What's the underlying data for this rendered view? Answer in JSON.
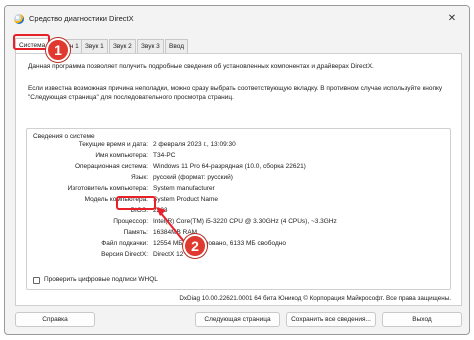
{
  "window": {
    "title": "Средство диагностики DirectX",
    "close_glyph": "✕"
  },
  "tabs": [
    "Система",
    "Экран 1",
    "Звук 1",
    "Звук 2",
    "Звук 3",
    "Ввод"
  ],
  "intro": {
    "line1": "Данная программа позволяет получить подробные сведения об установленных компонентах и драйверах DirectX.",
    "line2": "Если известна возможная причина неполадки, можно сразу выбрать соответствующую вкладку. В противном случае используйте кнопку \"Следующая страница\" для последовательного просмотра страниц."
  },
  "system_info": {
    "title": "Сведения о системе",
    "rows": [
      {
        "label": "Текущие время и дата:",
        "value": "2 февраля 2023 г., 13:09:30"
      },
      {
        "label": "Имя компьютера:",
        "value": "T34-PC"
      },
      {
        "label": "Операционная система:",
        "value": "Windows 11 Pro 64-разрядная (10.0, сборка 22621)"
      },
      {
        "label": "Язык:",
        "value": "русский (формат: русский)"
      },
      {
        "label": "Изготовитель компьютера:",
        "value": "System manufacturer"
      },
      {
        "label": "Модель компьютера:",
        "value": "System Product Name"
      },
      {
        "label": "BIOS:",
        "value": "2203"
      },
      {
        "label": "Процессор:",
        "value": "Intel(R) Core(TM) i5-3220 CPU @ 3.30GHz (4 CPUs), ~3.3GHz"
      },
      {
        "label": "Память:",
        "value": "16384MB RAM"
      },
      {
        "label": "Файл подкачки:",
        "value": "12554 МБ использовано, 6133 МБ свободно"
      },
      {
        "label": "Версия DirectX:",
        "value": "DirectX 12"
      }
    ]
  },
  "whql_checkbox": {
    "label": "Проверить цифровые подписи WHQL",
    "checked": false
  },
  "footer": "DxDiag 10.00.22621.0001 64 бита Юникод © Корпорация Майкрософт. Все права защищены.",
  "buttons": {
    "help": "Справка",
    "next_page": "Следующая страница",
    "save_all": "Сохранить все сведения...",
    "exit": "Выход"
  },
  "annotations": {
    "step1": "1",
    "step2": "2",
    "highlight_color": "#e8202a"
  }
}
